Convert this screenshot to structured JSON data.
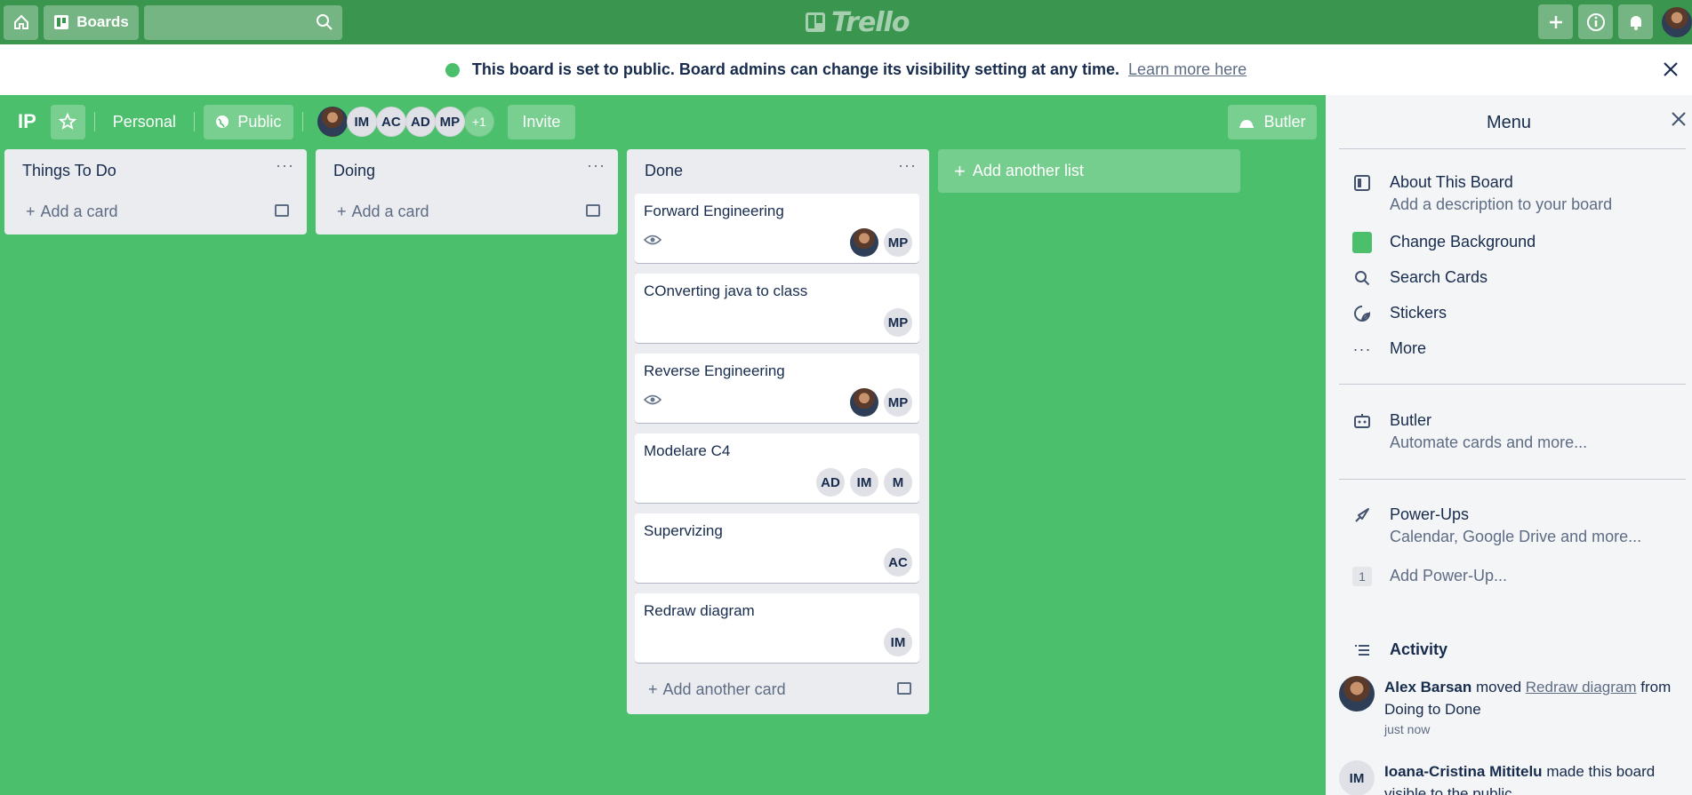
{
  "topbar": {
    "boards_label": "Boards",
    "search_placeholder": "",
    "logo_text": "Trello"
  },
  "banner": {
    "message": "This board is set to public. Board admins can change its visibility setting at any time.",
    "link": "Learn more here"
  },
  "board": {
    "name": "IP",
    "team_label": "Personal",
    "visibility_label": "Public",
    "members": [
      "IM",
      "AC",
      "AD",
      "MP"
    ],
    "more_members": "+1",
    "invite_label": "Invite",
    "butler_label": "Butler"
  },
  "lists": [
    {
      "title": "Things To Do",
      "add_label": "Add a card"
    },
    {
      "title": "Doing",
      "add_label": "Add a card"
    },
    {
      "title": "Done",
      "add_label": "Add another card",
      "cards": [
        {
          "title": "Forward Engineering",
          "members": [
            "MP"
          ]
        },
        {
          "title": "COnverting java to class",
          "members": [
            "MP"
          ]
        },
        {
          "title": "Reverse Engineering",
          "members": [
            "MP"
          ]
        },
        {
          "title": "Modelare C4",
          "members": [
            "AD",
            "IM",
            "M"
          ]
        },
        {
          "title": "Supervizing",
          "members": [
            "AC"
          ]
        },
        {
          "title": "Redraw diagram",
          "members": [
            "IM"
          ]
        }
      ]
    }
  ],
  "add_list_label": "Add another list",
  "menu": {
    "title": "Menu",
    "about_title": "About This Board",
    "about_sub": "Add a description to your board",
    "change_bg": "Change Background",
    "bg_color": "#4bbf6b",
    "search_cards": "Search Cards",
    "stickers": "Stickers",
    "more": "More",
    "butler_title": "Butler",
    "butler_sub": "Automate cards and more...",
    "powerups_title": "Power-Ups",
    "powerups_sub": "Calendar, Google Drive and more...",
    "add_powerup_count": "1",
    "add_powerup": "Add Power-Up...",
    "activity_title": "Activity",
    "activity": [
      {
        "user": "Alex Barsan",
        "action": "moved",
        "card": "Redraw diagram",
        "rest": "from Doing to Done",
        "time": "just now"
      },
      {
        "user": "Ioana-Cristina Mititelu",
        "initials": "IM",
        "action": "made this board visible to the public"
      }
    ]
  }
}
